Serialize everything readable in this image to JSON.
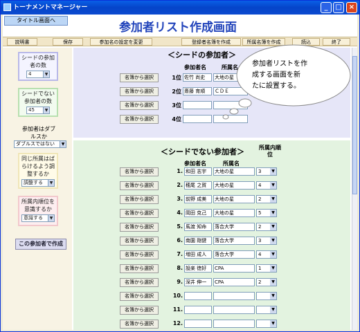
{
  "window": {
    "title": "トーナメントマネージャー",
    "min": "_",
    "max": "□",
    "close": "×"
  },
  "top_button": "タイトル画面へ",
  "page_title": "参加者リスト作成画面",
  "toolbar": {
    "items": [
      "説明書",
      "保存",
      "参加名の設定を変更",
      "登録者名簿を作成",
      "所属名簿を作成",
      "読込",
      "終了"
    ]
  },
  "left": {
    "seed_count_label": "シードの参加者の数",
    "seed_count_value": "4",
    "nonseed_count_label": "シードでない参加者の数",
    "nonseed_count_value": "45",
    "doubles_label": "参加者はダブルスか",
    "doubles_value": "ダブルスではない",
    "spread_label": "同じ所属はばらけるよう調整するか",
    "spread_value": "調整する",
    "rank_label": "所属内順位を意識するか",
    "rank_value": "意識する",
    "create_button": "この参加者で作成"
  },
  "seed": {
    "title": "＜シードの参加者＞",
    "col_name": "参加者名",
    "col_org": "所属名",
    "choose_label": "名簿から選択",
    "rows": [
      {
        "rank": "1位",
        "name": "佐竹 尚史",
        "org": "大地の星"
      },
      {
        "rank": "2位",
        "name": "斎藤 育順",
        "org": "ＣＤＥ"
      },
      {
        "rank": "3位",
        "name": "",
        "org": ""
      },
      {
        "rank": "4位",
        "name": "",
        "org": ""
      }
    ]
  },
  "nonseed": {
    "title": "＜シードでない参加者＞",
    "col_name": "参加者名",
    "col_org": "所属名",
    "col_rank": "所属内順位",
    "choose_label": "名簿から選択",
    "rows": [
      {
        "no": "1.",
        "name": "和田 志宇",
        "org": "大地の星",
        "rank": "3"
      },
      {
        "no": "2.",
        "name": "穂尾 之賀",
        "org": "大地の星",
        "rank": "4"
      },
      {
        "no": "3.",
        "name": "前野 成美",
        "org": "大地の星",
        "rank": "2"
      },
      {
        "no": "4.",
        "name": "岡田 克己",
        "org": "大地の星",
        "rank": "5"
      },
      {
        "no": "5.",
        "name": "馬渡 知命",
        "org": "落合大学",
        "rank": "2"
      },
      {
        "no": "6.",
        "name": "南園 剛健",
        "org": "落合大学",
        "rank": "3"
      },
      {
        "no": "7.",
        "name": "増田 成人",
        "org": "落合大学",
        "rank": "4"
      },
      {
        "no": "8.",
        "name": "設楽 徳好",
        "org": "CPA",
        "rank": "1"
      },
      {
        "no": "9.",
        "name": "深井 伸一",
        "org": "CPA",
        "rank": "2"
      },
      {
        "no": "10.",
        "name": "",
        "org": "",
        "rank": ""
      },
      {
        "no": "11.",
        "name": "",
        "org": "",
        "rank": ""
      },
      {
        "no": "12.",
        "name": "",
        "org": "",
        "rank": ""
      },
      {
        "no": "13.",
        "name": "",
        "org": "",
        "rank": ""
      }
    ]
  },
  "callout": {
    "lines": [
      "参加者リストを作",
      "成する画面を新",
      "たに設置する。"
    ]
  }
}
